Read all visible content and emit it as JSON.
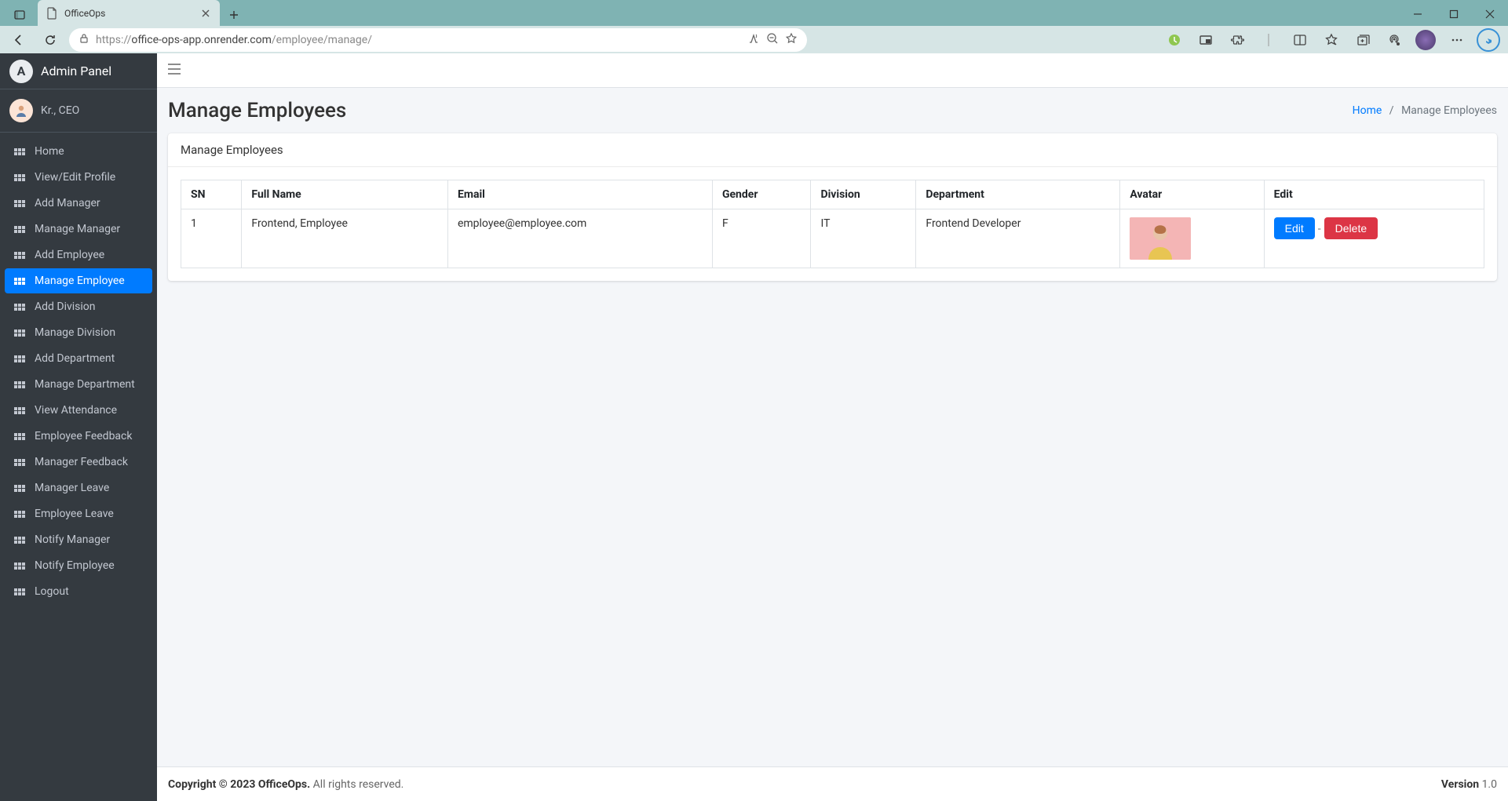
{
  "browser": {
    "tab_title": "OfficeOps",
    "url_prefix": "https://",
    "url_host": "office-ops-app.onrender.com",
    "url_path": "/employee/manage/"
  },
  "sidebar": {
    "brand": "Admin Panel",
    "user_name": "Kr., CEO",
    "items": [
      {
        "label": "Home"
      },
      {
        "label": "View/Edit Profile"
      },
      {
        "label": "Add Manager"
      },
      {
        "label": "Manage Manager"
      },
      {
        "label": "Add Employee"
      },
      {
        "label": "Manage Employee"
      },
      {
        "label": "Add Division"
      },
      {
        "label": "Manage Division"
      },
      {
        "label": "Add Department"
      },
      {
        "label": "Manage Department"
      },
      {
        "label": "View Attendance"
      },
      {
        "label": "Employee Feedback"
      },
      {
        "label": "Manager Feedback"
      },
      {
        "label": "Manager Leave"
      },
      {
        "label": "Employee Leave"
      },
      {
        "label": "Notify Manager"
      },
      {
        "label": "Notify Employee"
      },
      {
        "label": "Logout"
      }
    ],
    "active_index": 5
  },
  "page": {
    "title": "Manage Employees",
    "breadcrumb_home": "Home",
    "breadcrumb_current": "Manage Employees",
    "card_title": "Manage Employees"
  },
  "table": {
    "headers": [
      "SN",
      "Full Name",
      "Email",
      "Gender",
      "Division",
      "Department",
      "Avatar",
      "Edit"
    ],
    "rows": [
      {
        "sn": "1",
        "full_name": "Frontend, Employee",
        "email": "employee@employee.com",
        "gender": "F",
        "division": "IT",
        "department": "Frontend Developer"
      }
    ],
    "edit_label": "Edit",
    "delete_label": "Delete"
  },
  "footer": {
    "copyright_bold": "Copyright © 2023 OfficeOps.",
    "copyright_rest": " All rights reserved.",
    "version_label": "Version",
    "version_value": " 1.0"
  }
}
